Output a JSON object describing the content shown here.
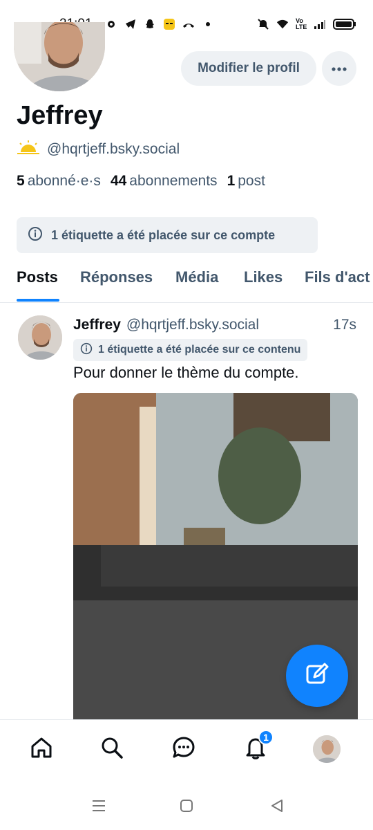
{
  "status_bar": {
    "time": "21:01",
    "network_label": "Vo LTE"
  },
  "profile": {
    "edit_button": "Modifier le profil",
    "display_name": "Jeffrey",
    "handle": "@hqrtjeff.bsky.social",
    "followers_count": "5",
    "followers_label": "abonné·e·s",
    "following_count": "44",
    "following_label": "abonnements",
    "posts_count": "1",
    "posts_label": "post",
    "label_notice": "1 étiquette a été placée sur ce compte"
  },
  "tabs": [
    {
      "label": "Posts",
      "active": true
    },
    {
      "label": "Réponses",
      "active": false
    },
    {
      "label": "Média",
      "active": false
    },
    {
      "label": "Likes",
      "active": false
    },
    {
      "label": "Fils d'act",
      "active": false
    }
  ],
  "post": {
    "author": "Jeffrey",
    "handle": "@hqrtjeff.bsky.social",
    "time": "17s",
    "label_notice": "1 étiquette a été placée sur ce contenu",
    "text": "Pour donner le thème du compte.",
    "media": "photo (explicit content, obscured)"
  },
  "bottom_nav": {
    "items": [
      "home-icon",
      "search-icon",
      "chat-icon",
      "bell-icon",
      "profile-avatar"
    ],
    "notification_badge": "1"
  },
  "colors": {
    "accent": "#1083fe",
    "muted_text": "#42576c",
    "chip_bg": "#eef1f4"
  }
}
